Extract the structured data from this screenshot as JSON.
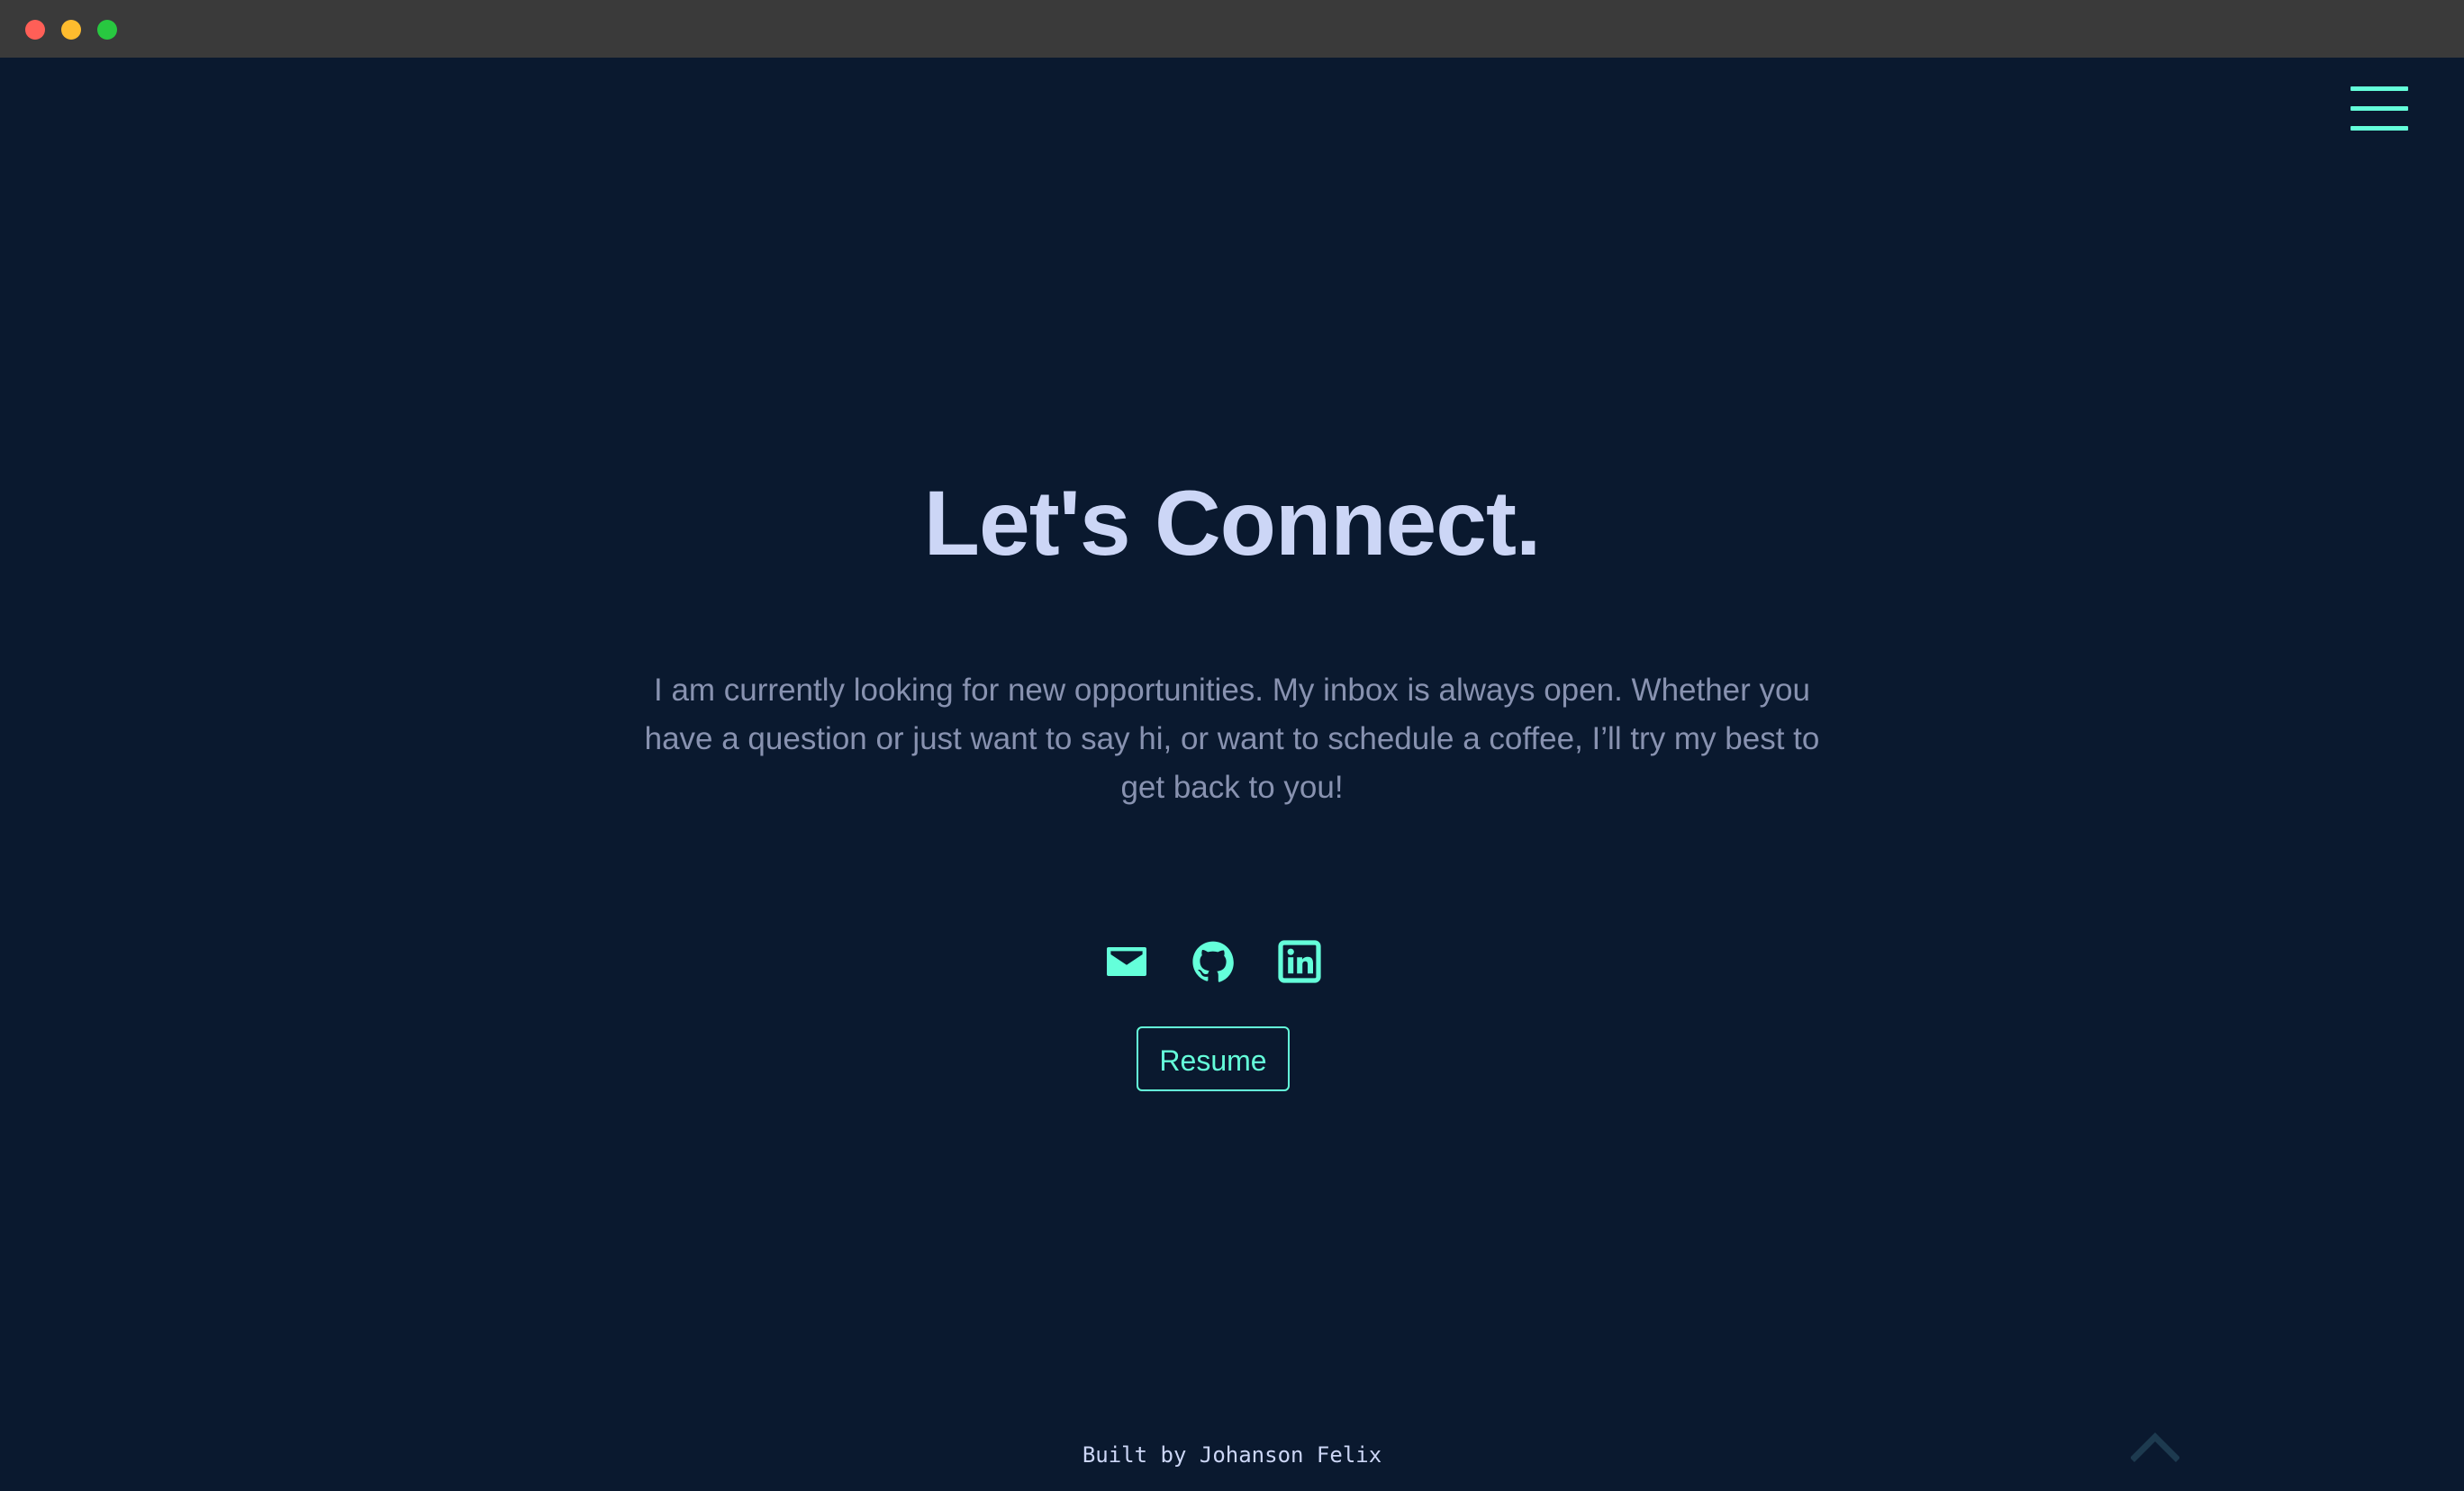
{
  "window": {
    "controls": [
      "close",
      "minimize",
      "maximize"
    ]
  },
  "header": {
    "menu_icon": "hamburger-menu-icon"
  },
  "contact": {
    "title": "Let's Connect.",
    "description": "I am currently looking for new opportunities. My inbox is always open. Whether you have a question or just want to say hi, or want to schedule a coffee, I’ll try my best to get back to you!",
    "social_icons": [
      "mail-icon",
      "github-icon",
      "linkedin-icon"
    ],
    "resume_label": "Resume"
  },
  "footer": {
    "credit": "Built by Johanson Felix",
    "scroll_top_icon": "chevron-up-icon"
  },
  "colors": {
    "background": "#0a192f",
    "accent": "#64ffda",
    "heading": "#ccd6f6",
    "body_text": "#8892b0",
    "titlebar": "#3a3a3a"
  }
}
